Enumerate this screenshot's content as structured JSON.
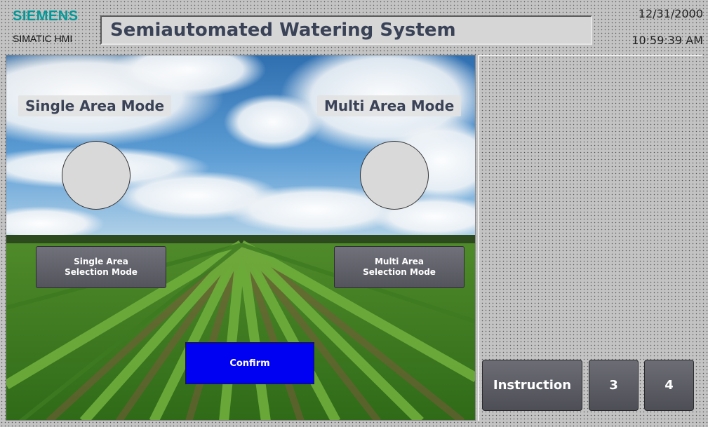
{
  "header": {
    "brand": "SIEMENS",
    "brand_sub": "SIMATIC HMI",
    "title": "Semiautomated Watering System",
    "date": "12/31/2000",
    "time": "10:59:39 AM"
  },
  "modes": {
    "single": {
      "label": "Single Area Mode",
      "button": "Single Area\nSelection Mode"
    },
    "multi": {
      "label": "Multi Area Mode",
      "button": "Multi Area\nSelection Mode"
    }
  },
  "confirm_label": "Confirm",
  "nav": {
    "instruction": "Instruction",
    "screen_3": "3",
    "screen_4": "4"
  },
  "colors": {
    "brand": "#009999",
    "confirm": "#0000f2",
    "button": "#5e5f67",
    "background": "#c3c3c3"
  },
  "icons": {
    "single_indicator": "status-indicator",
    "multi_indicator": "status-indicator"
  }
}
